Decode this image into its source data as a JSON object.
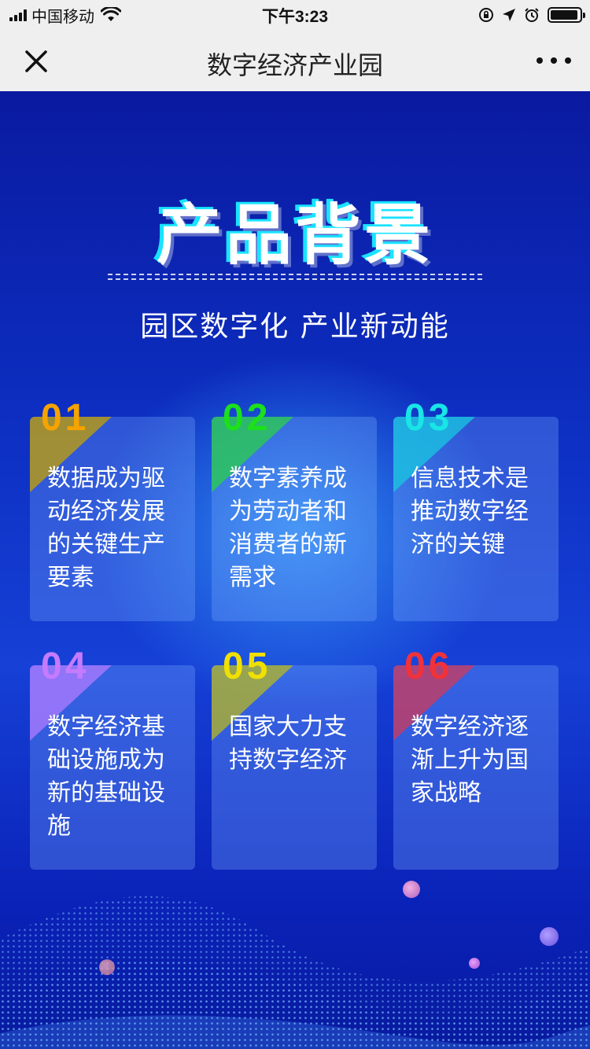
{
  "status_bar": {
    "carrier": "中国移动",
    "time": "下午3:23",
    "icons": [
      "signal-icon",
      "wifi-icon",
      "orientation-lock-icon",
      "location-icon",
      "alarm-icon",
      "battery-icon"
    ]
  },
  "nav": {
    "title": "数字经济产业园",
    "close_icon": "close-icon",
    "more_icon": "more-icon"
  },
  "main": {
    "heading": "产品背景",
    "subtitle": "园区数字化  产业新动能",
    "cards": [
      {
        "num": "01",
        "text": "数据成为驱动经济发展的关键生产要素",
        "color": "#f5a300"
      },
      {
        "num": "02",
        "text": "数字素养成为劳动者和消费者的新需求",
        "color": "#1be01b"
      },
      {
        "num": "03",
        "text": "信息技术是推动数字经济的关键",
        "color": "#18e6e6"
      },
      {
        "num": "04",
        "text": "数字经济基础设施成为新的基础设施",
        "color": "#c57bff"
      },
      {
        "num": "05",
        "text": "国家大力支持数字经济",
        "color": "#f0e000"
      },
      {
        "num": "06",
        "text": "数字经济逐渐上升为国家战略",
        "color": "#f0323a"
      }
    ]
  },
  "colors": {
    "bar_bg": "#efefef",
    "bg_deep_blue": "#0a1aa0",
    "heading_glow": "#19e3ff"
  }
}
